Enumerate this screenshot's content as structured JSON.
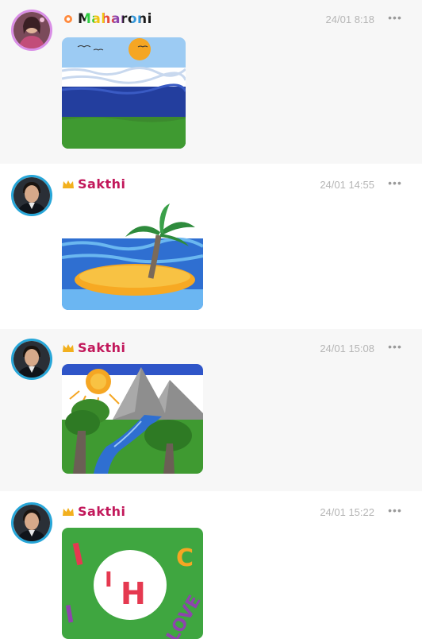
{
  "posts": [
    {
      "username": "Maharoni",
      "time": "24/01 8:18",
      "more_label": "•••",
      "avatar_icon": "user-avatar-woman-icon",
      "badge_icon": "flower-badge-icon",
      "drawing": "beach-sun-birds-drawing"
    },
    {
      "username": "Sakthi",
      "time": "24/01 14:55",
      "more_label": "•••",
      "avatar_icon": "user-avatar-man-icon",
      "badge_icon": "crown-icon",
      "drawing": "palm-island-drawing"
    },
    {
      "username": "Sakthi",
      "time": "24/01 15:08",
      "more_label": "•••",
      "avatar_icon": "user-avatar-man-icon",
      "badge_icon": "crown-icon",
      "drawing": "mountain-river-drawing"
    },
    {
      "username": "Sakthi",
      "time": "24/01 15:22",
      "more_label": "•••",
      "avatar_icon": "user-avatar-man-icon",
      "badge_icon": "crown-icon",
      "drawing": "ihc-love-drawing",
      "drawing_text": [
        "I",
        "H",
        "C",
        "LOVE"
      ]
    }
  ]
}
